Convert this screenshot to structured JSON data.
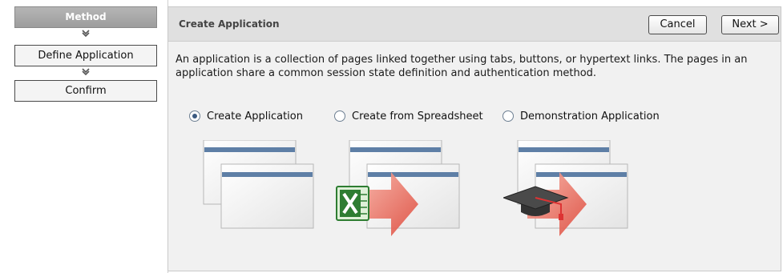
{
  "wizard": {
    "steps": [
      {
        "label": "Method",
        "current": true
      },
      {
        "label": "Define Application",
        "current": false
      },
      {
        "label": "Confirm",
        "current": false
      }
    ],
    "arrow_glyph": "⌄"
  },
  "panel": {
    "title": "Create Application",
    "cancel_label": "Cancel",
    "next_label": "Next >",
    "description": "An application is a collection of pages linked together using tabs, buttons, or hypertext links. The pages in an application share a common session state definition and authentication method."
  },
  "options": [
    {
      "label": "Create Application",
      "checked": true,
      "icon": "window-stack-icon"
    },
    {
      "label": "Create from Spreadsheet",
      "checked": false,
      "icon": "spreadsheet-arrow-icon"
    },
    {
      "label": "Demonstration Application",
      "checked": false,
      "icon": "graduation-cap-arrow-icon"
    }
  ],
  "colors": {
    "panel_bg": "#f1f1f1",
    "header_bg": "#e0e0e0",
    "window_titlebar": "#5e7fa6",
    "arrow": "#e76a5f",
    "excel_green": "#2e7d32"
  }
}
